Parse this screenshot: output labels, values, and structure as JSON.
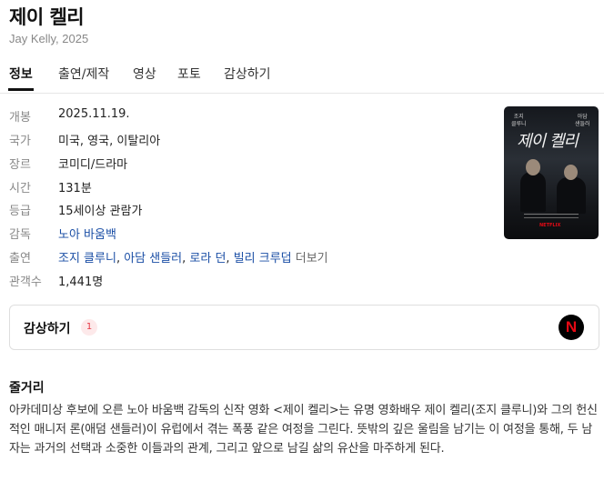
{
  "title": "제이 켈리",
  "subtitle": "Jay Kelly, 2025",
  "tabs": [
    {
      "label": "정보"
    },
    {
      "label": "출연/제작"
    },
    {
      "label": "영상"
    },
    {
      "label": "포토"
    },
    {
      "label": "감상하기"
    }
  ],
  "info": {
    "release": {
      "label": "개봉",
      "value": "2025.11.19."
    },
    "country": {
      "label": "국가",
      "value": "미국, 영국, 이탈리아"
    },
    "genre": {
      "label": "장르",
      "value": "코미디/드라마"
    },
    "runtime": {
      "label": "시간",
      "value": "131분"
    },
    "rating": {
      "label": "등급",
      "value": "15세이상 관람가"
    },
    "director": {
      "label": "감독",
      "value": "노아 바움백"
    },
    "cast": {
      "label": "출연",
      "names": [
        "조지 클루니",
        "아담 샌들러",
        "로라 던",
        "빌리 크루덥"
      ],
      "sep": ", ",
      "more": "더보기"
    },
    "audience": {
      "label": "관객수",
      "value": "1,441명"
    }
  },
  "poster": {
    "name_left": [
      "조지",
      "클루니"
    ],
    "name_right": [
      "아담",
      "샌들러"
    ],
    "title": "제이 켈리",
    "badge": "NETFLIX"
  },
  "watch": {
    "label": "감상하기",
    "count": "1",
    "provider_letter": "N",
    "icon": "netflix-icon"
  },
  "synopsis": {
    "title": "줄거리",
    "text": "아카데미상 후보에 오른 노아 바움백 감독의 신작 영화 <제이 켈리>는 유명 영화배우 제이 켈리(조지 클루니)와 그의 헌신적인 매니저 론(애덤 샌들러)이 유럽에서 겪는 폭풍 같은 여정을 그린다. 뜻밖의 깊은 울림을 남기는 이 여정을 통해, 두 남자는 과거의 선택과 소중한 이들과의 관계, 그리고 앞으로 남길 삶의 유산을 마주하게 된다."
  },
  "colors": {
    "link": "#1a4ea5",
    "accent_badge": "#e53845",
    "netflix_red": "#e50914"
  }
}
